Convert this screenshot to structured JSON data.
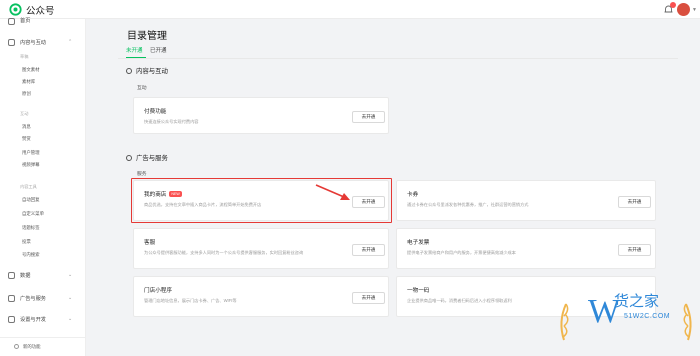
{
  "app": {
    "brand": "公众号"
  },
  "sidebar": {
    "home": "首页",
    "content_interaction": "内容与互动",
    "content_items": [
      "草稿",
      "图文素材",
      "素材库",
      "原创"
    ],
    "manage_group": "互动",
    "manage_items": [
      "消息",
      "赞赏",
      "用户管理",
      "视频弹幕"
    ],
    "tools_group": "内容工具",
    "tools_items": [
      "自动回复",
      "自定义菜单",
      "话题标签",
      "投票",
      "号内搜索"
    ],
    "data": "数据",
    "ads_service": "广告与服务",
    "settings_dev": "设置与开发",
    "bottom_link": "新的功能"
  },
  "main": {
    "title": "目录管理",
    "tabs": [
      "未开通",
      "已开通"
    ],
    "section_content": "内容与互动",
    "content_sub": "互动",
    "section_ads": "广告与服务",
    "ads_sub": "服务",
    "cta": "去开通"
  },
  "cards": [
    {
      "title": "付费功能",
      "desc": "快速连接公众号实现付费内容",
      "badge": ""
    },
    {
      "title": "我的商店",
      "desc": "商品优选，支持在文章中插入商品卡片，流程简单开始免费开店",
      "badge": "NEW"
    },
    {
      "title": "卡券",
      "desc": "通过卡券在公众号里派发各种优惠券，推广，社群运营的营销方式",
      "badge": ""
    },
    {
      "title": "客服",
      "desc": "为公众号提供客服功能，支持多人同时为一个公众号提供客服服务，实时回复粉丝咨询",
      "badge": ""
    },
    {
      "title": "电子发票",
      "desc": "提供电子发票给商户和用户的服务，开票便捷高效减少成本",
      "badge": ""
    },
    {
      "title": "门店小程序",
      "desc": "管理门店地址信息，展示门店卡券、广告、WIFI等",
      "badge": ""
    },
    {
      "title": "一物一码",
      "desc": "企业提供商品唯一码，消费者扫码后进入小程序领取返利",
      "badge": ""
    }
  ],
  "watermark": {
    "brand": "货之家",
    "url": "51W2C.COM"
  },
  "colors": {
    "accent": "#07c160",
    "highlight": "#e53935",
    "badge": "#fa5151"
  }
}
